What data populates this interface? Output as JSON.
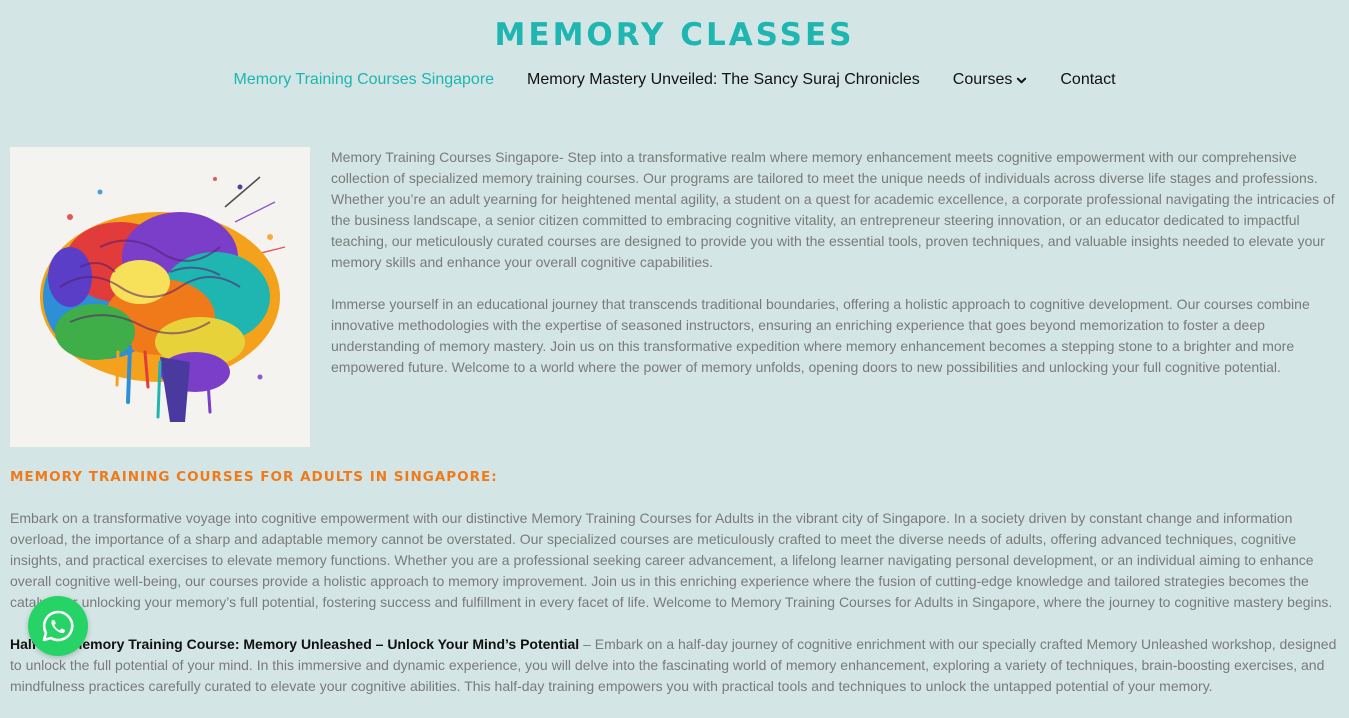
{
  "site": {
    "title": "MEMORY CLASSES"
  },
  "nav": {
    "items": [
      {
        "label": "Memory Training Courses Singapore",
        "active": true
      },
      {
        "label": "Memory Mastery Unveiled: The Sancy Suraj Chronicles"
      },
      {
        "label": "Courses",
        "icon": "chevron-down-icon"
      },
      {
        "label": "Contact"
      }
    ]
  },
  "colors": {
    "background": "#d3e6e5",
    "accent": "#1fb5b1",
    "heading_orange": "#f07a1a",
    "whatsapp_green": "#25d366"
  },
  "intro": {
    "image_icon": "colorful-brain-illustration",
    "paragraphs": [
      "Memory Training Courses Singapore- Step into a transformative realm where memory enhancement meets cognitive empowerment with our comprehensive collection of specialized memory training courses. Our programs are tailored to meet the unique needs of individuals across diverse life stages and professions. Whether you’re an adult yearning for heightened mental agility, a student on a quest for academic excellence, a corporate professional navigating the intricacies of the business landscape, a senior citizen committed to embracing cognitive vitality, an entrepreneur steering innovation, or an educator dedicated to impactful teaching, our meticulously curated courses are designed to provide you with the essential tools, proven techniques, and valuable insights needed to elevate your memory skills and enhance your overall cognitive capabilities.",
      "Immerse yourself in an educational journey that transcends traditional boundaries, offering a holistic approach to cognitive development. Our courses combine innovative methodologies with the expertise of seasoned instructors, ensuring an enriching experience that goes beyond memorization to foster a deep understanding of memory mastery. Join us on this transformative expedition where memory enhancement becomes a stepping stone to a brighter and more empowered future. Welcome to a world where the power of memory unfolds, opening doors to new possibilities and unlocking your full cognitive potential."
    ]
  },
  "adults_section": {
    "heading": "MEMORY TRAINING COURSES FOR ADULTS IN SINGAPORE:",
    "paragraph": "Embark on a transformative voyage into cognitive empowerment with our distinctive Memory Training Courses for Adults in the vibrant city of Singapore. In a society driven by constant change and information overload, the importance of a sharp and adaptable memory cannot be overstated. Our specialized courses are meticulously crafted to meet the diverse needs of adults, offering advanced techniques, cognitive insights, and practical exercises to elevate memory functions. Whether you are a professional seeking career advancement, a lifelong learner navigating personal development, or an individual aiming to enhance overall cognitive well-being, our courses provide a holistic approach to memory improvement. Join us in this enriching experience where the fusion of cutting-edge knowledge and tailored strategies becomes the catalyst for unlocking your memory’s full potential, fostering success and fulfillment in every facet of life. Welcome to Memory Training Courses for Adults in Singapore, where the journey to cognitive mastery begins.",
    "course_title": "Half-Day Memory Training Course: Memory Unleashed – Unlock Your Mind’s Potential",
    "course_text": " – Embark on a half-day journey of cognitive enrichment with our specially crafted Memory Unleashed workshop, designed to unlock the full potential of your mind. In this immersive and dynamic experience, you will delve into the fascinating world of memory enhancement, exploring a variety of techniques, brain-boosting exercises, and mindfulness practices carefully curated to elevate your cognitive abilities. This half-day training empowers you with practical tools and techniques to unlock the untapped potential of your memory."
  },
  "whatsapp": {
    "icon": "whatsapp-icon"
  }
}
